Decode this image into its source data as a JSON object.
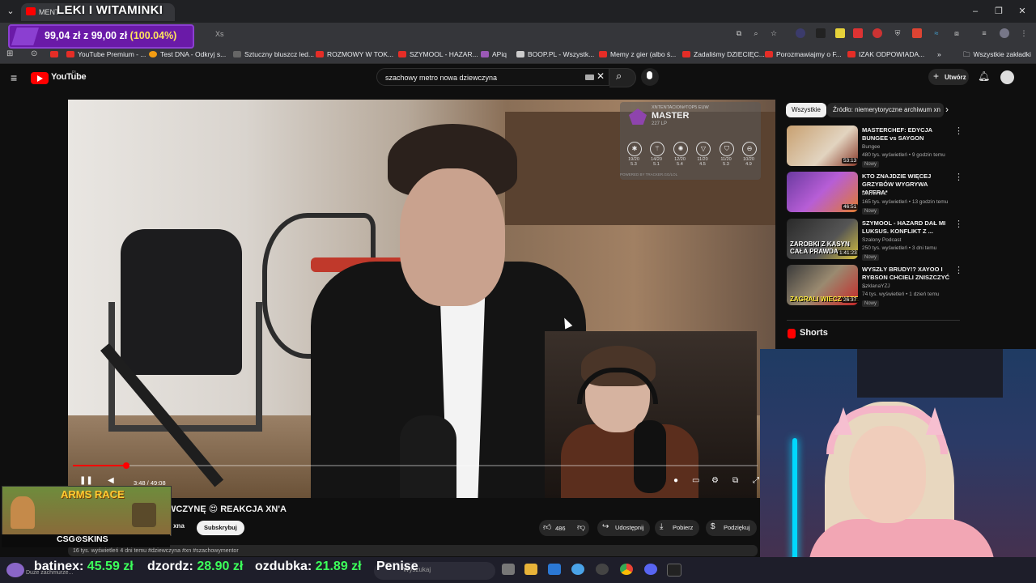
{
  "browser": {
    "tab_title": "MENT",
    "address_suffix": "Xs",
    "bookmarks": [
      "YouTube Premium - ...",
      "Test DNA - Odkryj s...",
      "Sztuczny bluszcz led...",
      "ROZMOWY W TOK...",
      "SZYMOOL - HAZAR...",
      "APiq",
      "BOOP.PL - Wszystk...",
      "Memy z gier (albo ś...",
      "Zadaliśmy DZIECIĘC...",
      "Porozmawiajmy o F...",
      "IZAK ODPOWIADA..."
    ],
    "all_bookmarks": "Wszystkie zakładki"
  },
  "youtube": {
    "logo": "YouTube",
    "logo_region": "PL",
    "search_value": "szachowy metro nowa dziewczyna",
    "create_label": "Utwórz"
  },
  "player": {
    "time": "3:48 / 49:08",
    "progress_fraction": 0.0775
  },
  "stats_overlay": {
    "player": "XNTENTACION#TOP5 EUW",
    "rank": "MASTER",
    "lp": "227 LP",
    "powered": "POWERED BY TRACKER.GG/LOL",
    "games": [
      {
        "score": "19/20",
        "kda": "5.3"
      },
      {
        "score": "14/20",
        "kda": "5.1"
      },
      {
        "score": "12/20",
        "kda": "5.4"
      },
      {
        "score": "11/20",
        "kda": "4.5"
      },
      {
        "score": "11/20",
        "kda": "5.3"
      },
      {
        "score": "10/20",
        "kda": "4.9"
      }
    ]
  },
  "video": {
    "title": "WCZYNĘ 😍 REAKCJA XN'A",
    "channel_partial": "n xna",
    "subscribe": "Subskrybuj",
    "likes": "486",
    "share": "Udostępnij",
    "download": "Pobierz",
    "thanks": "Podziękuj",
    "description": "16 tys. wyświetleń  4 dni temu  #dziewczyna #xn #szachowymentor"
  },
  "sidebar": {
    "chips": [
      "Wszystkie",
      "Źródło: niemerytoryczne archiwum xn"
    ],
    "items": [
      {
        "title": "MASTERCHEF: EDYCJA BUNGEE vs SAYGON",
        "channel": "Bungee",
        "meta": "480 tys. wyświetleń • 9 godzin temu",
        "badge": "Nowy",
        "duration": "53:13"
      },
      {
        "title": "KTO ZNAJDZIE WIĘCEJ GRZYBÓW WYGRYWA *AFERA*",
        "channel": "EKIPA WK",
        "meta": "165 tys. wyświetleń • 13 godzin temu",
        "badge": "Nowy",
        "duration": "46:51"
      },
      {
        "title": "SZYMOOL - HAZARD DAŁ MI LUKSUS. KONFLIKT Z ...",
        "channel": "Szalony Podcast",
        "meta": "250 tys. wyświetleń • 3 dni temu",
        "badge": "Nowy",
        "duration": "1:41:23",
        "thumb_text": "ZAROBKI Z KASYN CAŁA PRAWDA"
      },
      {
        "title": "WYSZŁY BRUDY!? XAYOO I RYBSON CHCIELI ZNISZCZYĆ ...",
        "channel": "SzklanaYZJ",
        "meta": "74 tys. wyświetleń • 1 dzień temu",
        "badge": "Nowy",
        "duration": "26:37",
        "thumb_text": "ZAGRALI WIECZYSTE"
      }
    ],
    "shorts_label": "Shorts"
  },
  "stream_overlay": {
    "title": "LEKI I WITAMINKI",
    "goal_current": "99,04 zł",
    "goal_sep": "z",
    "goal_target": "99,00 zł",
    "goal_percent": "(100.04%)",
    "arms_race": "ARMS RACE",
    "csgo_skins": "CSG⊙SKINS",
    "ticker": [
      {
        "name": "batinex:",
        "value": "45.59 zł"
      },
      {
        "name": "dzordz:",
        "value": "28.90 zł"
      },
      {
        "name": "ozdubka:",
        "value": "21.89 zł"
      },
      {
        "name": "Penise",
        "value": ""
      }
    ],
    "faint_caption": "Duże zachmurze...",
    "taskbar_search": "Wyszukaj"
  },
  "colors": {
    "yt_red": "#ff0000",
    "goal_purple": "#6a1aa8",
    "ticker_green": "#3cff5a"
  }
}
